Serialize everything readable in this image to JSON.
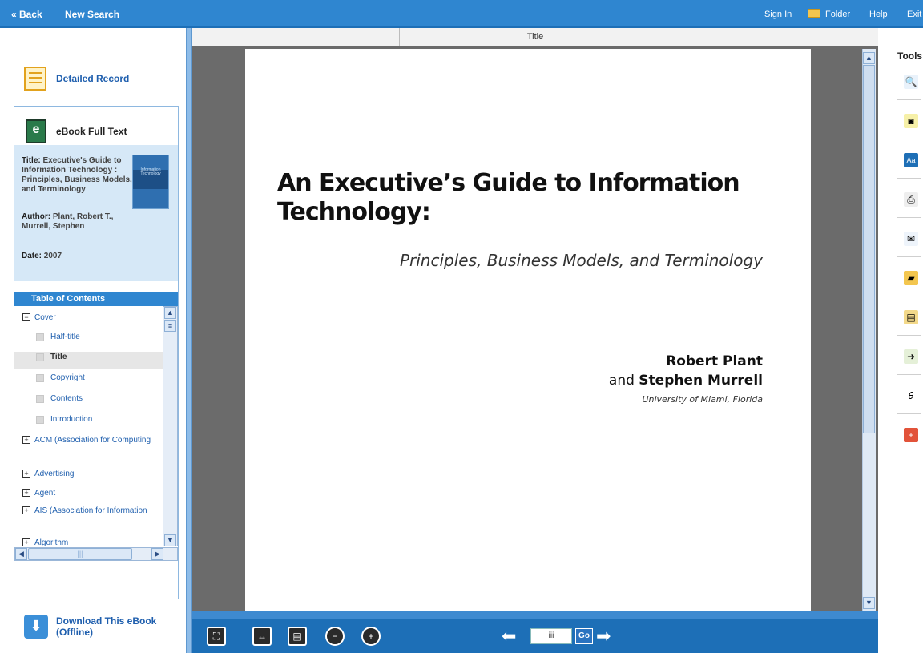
{
  "topbar": {
    "back": "« Back",
    "new_search": "New Search",
    "sign_in": "Sign In",
    "folder": "Folder",
    "help": "Help",
    "exit": "Exit"
  },
  "left": {
    "detailed_record": "Detailed Record",
    "ebook_full_text": "eBook Full Text",
    "title_label": "Title:",
    "title_value": "Executive's Guide to Information Technology : Principles, Business Models, and Terminology",
    "author_label": "Author:",
    "author_value": "Plant, Robert T., Murrell, Stephen",
    "date_label": "Date:",
    "date_value": "2007",
    "cover_text": "Information Technology",
    "toc_header": "Table of Contents",
    "toc": [
      {
        "label": "Cover",
        "kind": "minus"
      },
      {
        "label": "Half-title",
        "kind": "leaf"
      },
      {
        "label": "Title",
        "kind": "leaf-selected"
      },
      {
        "label": "Copyright",
        "kind": "leaf"
      },
      {
        "label": "Contents",
        "kind": "leaf"
      },
      {
        "label": "Introduction",
        "kind": "leaf"
      },
      {
        "label": "ACM (Association for Computing",
        "kind": "plus"
      },
      {
        "label": "Advertising",
        "kind": "plus"
      },
      {
        "label": "Agent",
        "kind": "plus"
      },
      {
        "label": "AIS (Association for Information",
        "kind": "plus"
      },
      {
        "label": "Algorithm",
        "kind": "plus"
      }
    ],
    "download": "Download This eBook (Offline)"
  },
  "viewer": {
    "tab_title": "Title",
    "book_title": "An Executive’s Guide to Information Technology:",
    "subtitle": "Principles, Business Models, and Terminology",
    "author1": "Robert Plant",
    "and": "and",
    "author2": "Stephen Murrell",
    "affiliation": "University of Miami, Florida",
    "page_number": "iii",
    "go": "Go"
  },
  "tools": {
    "header": "Tools",
    "items": [
      "search-icon",
      "image-icon",
      "dictionary-icon",
      "print-icon",
      "email-icon",
      "folder-icon",
      "notes-icon",
      "export-icon",
      "link-icon",
      "add-icon"
    ]
  }
}
